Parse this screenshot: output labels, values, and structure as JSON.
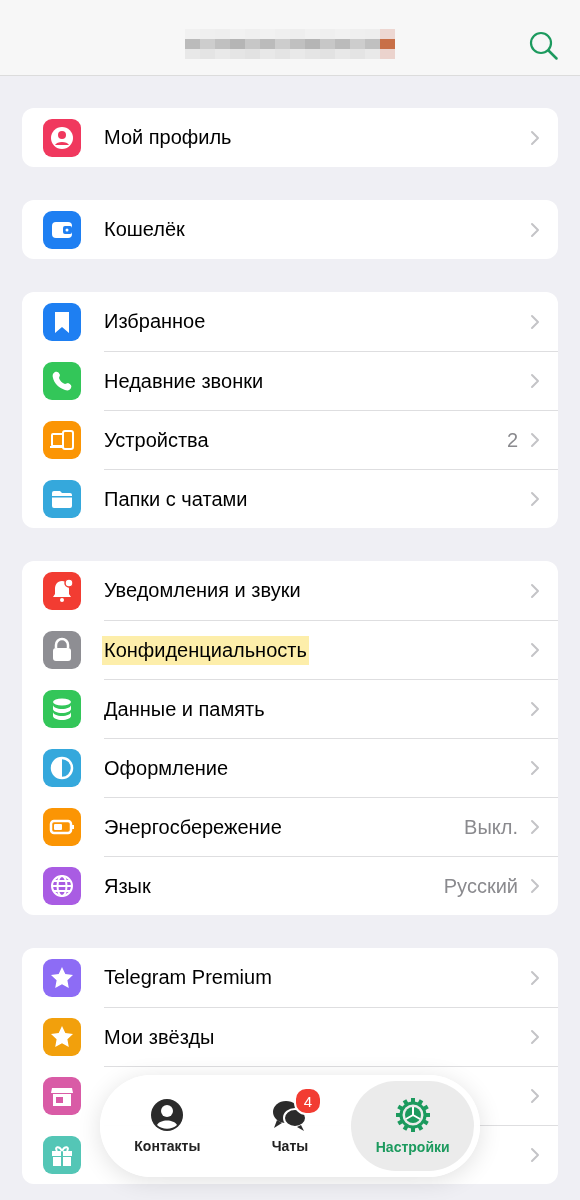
{
  "groups": [
    {
      "items": [
        {
          "kind": "row",
          "label": "Мой профиль"
        }
      ]
    },
    {
      "items": [
        {
          "kind": "row",
          "label": "Кошелёк"
        }
      ]
    },
    {
      "items": [
        {
          "kind": "row",
          "label": "Избранное"
        },
        {
          "kind": "row",
          "label": "Недавние звонки"
        },
        {
          "kind": "row",
          "label": "Устройства",
          "value": "2"
        },
        {
          "kind": "row",
          "label": "Папки с чатами"
        }
      ]
    },
    {
      "items": [
        {
          "kind": "row",
          "label": "Уведомления и звуки"
        },
        {
          "kind": "row",
          "label": "Конфиденциальность",
          "highlighted": true
        },
        {
          "kind": "row",
          "label": "Данные и память"
        },
        {
          "kind": "row",
          "label": "Оформление"
        },
        {
          "kind": "row",
          "label": "Энергосбережение",
          "value": "Выкл."
        },
        {
          "kind": "row",
          "label": "Язык",
          "value": "Русский"
        }
      ]
    },
    {
      "items": [
        {
          "kind": "row",
          "label": "Telegram Premium"
        },
        {
          "kind": "row",
          "label": "Мои звёзды"
        },
        {
          "kind": "covered"
        },
        {
          "kind": "covered"
        }
      ]
    }
  ],
  "tab_bar": [
    {
      "label": "Контакты",
      "selected": false
    },
    {
      "label": "Чаты",
      "badge": "4",
      "selected": false
    },
    {
      "label": "Настройки",
      "selected": true
    }
  ]
}
